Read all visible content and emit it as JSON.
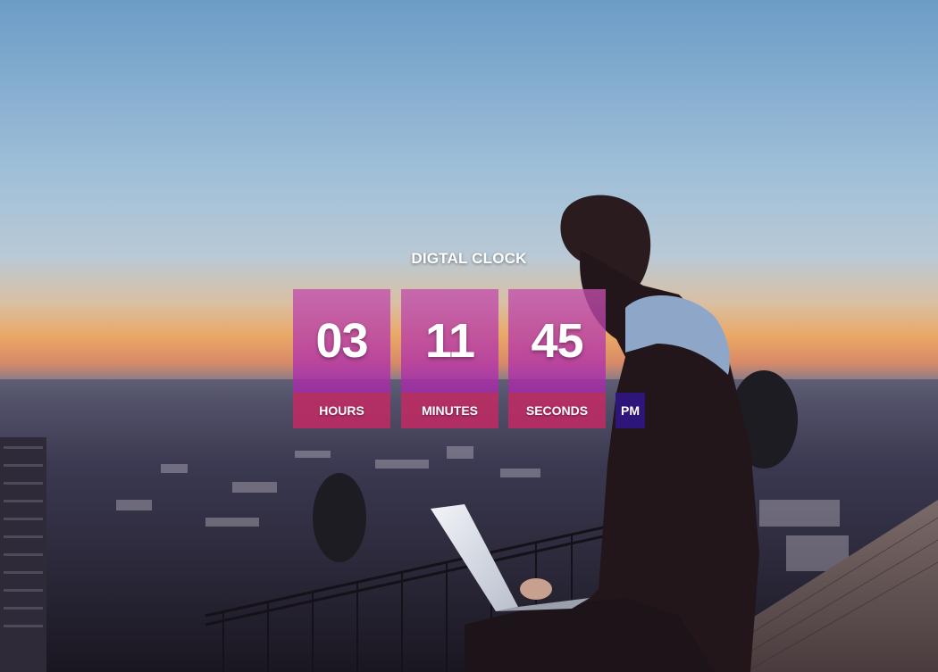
{
  "clock": {
    "title": "DIGTAL CLOCK",
    "hours": "03",
    "minutes": "11",
    "seconds": "45",
    "hours_label": "HOURS",
    "minutes_label": "MINUTES",
    "seconds_label": "SECONDS",
    "period": "PM"
  },
  "colors": {
    "digit_panel": "#c050aa",
    "label_bar": "#c82864",
    "period_badge": "#2e157a",
    "sky_top": "#6f9fc8",
    "sky_horizon": "#e9a060"
  },
  "background": {
    "scene": "person-with-laptop-city-sunset-image"
  }
}
